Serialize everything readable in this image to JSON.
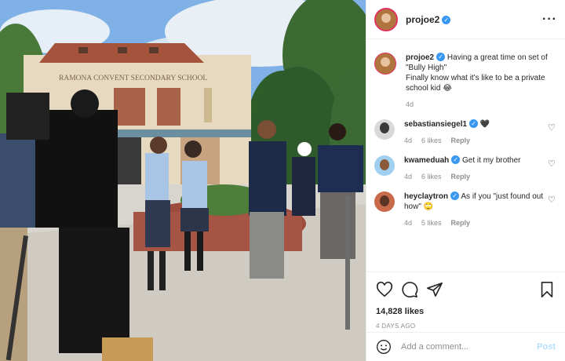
{
  "post": {
    "username": "projoe2",
    "caption_line1": "Having a great time on set of \"Bully High\"",
    "caption_line2": "Finally know what it's like to be a private school kid 😂",
    "caption_age": "4d",
    "photo_sign_text": "RAMONA CONVENT SECONDARY SCHOOL"
  },
  "comments": [
    {
      "username": "sebastiansiegel1",
      "verified": true,
      "text": "🖤",
      "age": "4d",
      "likes": "6 likes",
      "reply": "Reply"
    },
    {
      "username": "kwameduah",
      "verified": true,
      "text": "Get it my brother",
      "age": "4d",
      "likes": "6 likes",
      "reply": "Reply"
    },
    {
      "username": "heyclaytron",
      "verified": true,
      "text": "As if you \"just found out how\" 🙄",
      "age": "4d",
      "likes": "5 likes",
      "reply": "Reply"
    }
  ],
  "stats": {
    "likes": "14,828 likes",
    "date": "4 DAYS AGO"
  },
  "add_comment": {
    "placeholder": "Add a comment...",
    "post_label": "Post"
  },
  "icons": {
    "more": "more-options-icon",
    "heart": "heart-icon",
    "comment": "comment-icon",
    "share": "share-icon",
    "bookmark": "bookmark-icon",
    "emoji": "emoji-icon",
    "verified": "verified-badge-icon"
  },
  "colors": {
    "verified": "#3897f0",
    "post_disabled": "#b2dffc",
    "story_ring": "#e0335e"
  }
}
